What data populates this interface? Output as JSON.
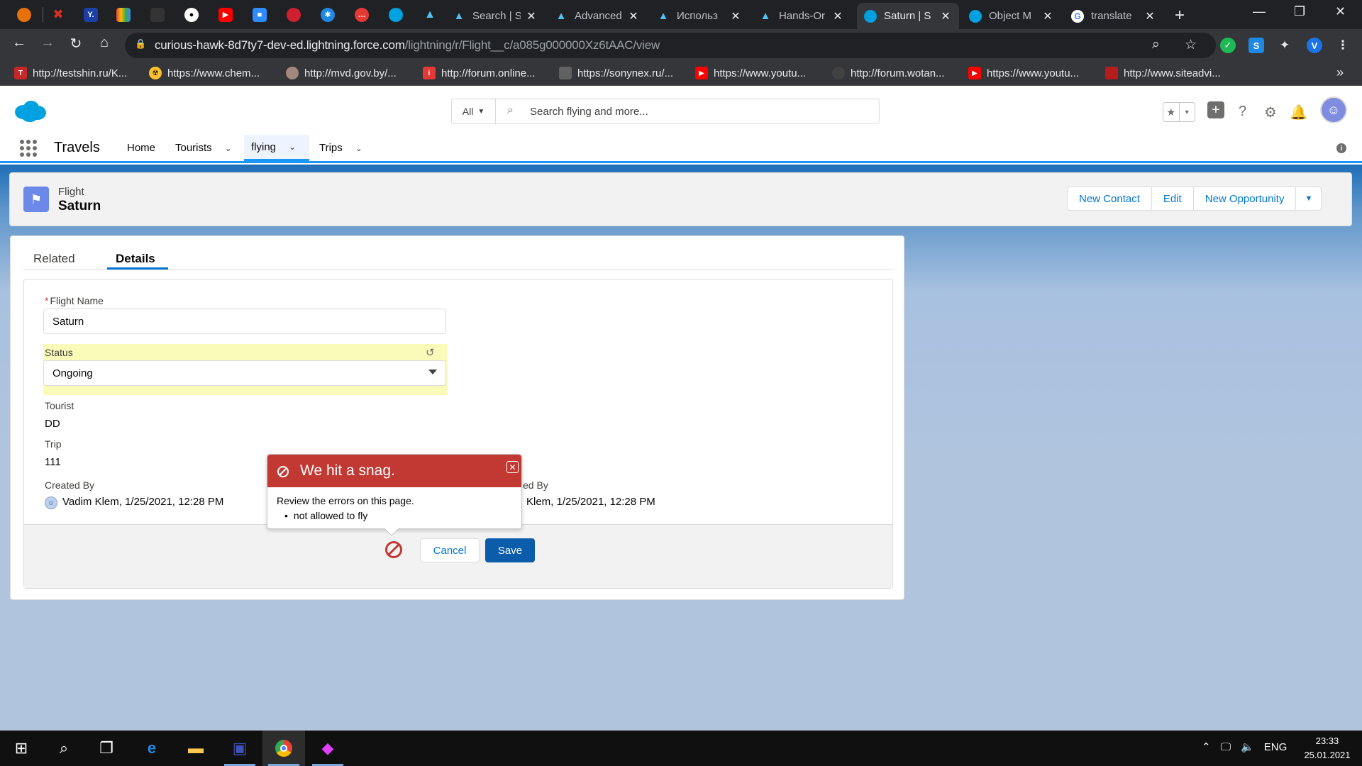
{
  "browser": {
    "tabs": [
      {
        "label": "Search | S",
        "icon": "trailhead-icon"
      },
      {
        "label": "Advanced",
        "icon": "trailhead-icon"
      },
      {
        "label": "Использ",
        "icon": "trailhead-icon"
      },
      {
        "label": "Hands-Or",
        "icon": "trailhead-icon"
      },
      {
        "label": "Saturn | S",
        "icon": "salesforce-icon",
        "active": true
      },
      {
        "label": "Object M",
        "icon": "salesforce-icon"
      },
      {
        "label": "translate",
        "icon": "google-icon"
      }
    ],
    "url_host": "curious-hawk-8d7ty7-dev-ed.lightning.force.com",
    "url_path": "/lightning/r/Flight__c/a085g000000Xz6tAAC/view",
    "profile_initial": "V",
    "bookmarks": [
      "http://testshin.ru/K...",
      "https://www.chem...",
      "http://mvd.gov.by/...",
      "http://forum.online...",
      "https://sonynex.ru/...",
      "https://www.youtu...",
      "http://forum.wotan...",
      "https://www.youtu...",
      "http://www.siteadvi..."
    ]
  },
  "sf": {
    "search_scope": "All",
    "search_placeholder": "Search flying and more...",
    "app_name": "Travels",
    "nav": [
      {
        "label": "Home"
      },
      {
        "label": "Tourists"
      },
      {
        "label": "flying",
        "active": true
      },
      {
        "label": "Trips"
      }
    ]
  },
  "record": {
    "type": "Flight",
    "title": "Saturn",
    "actions": [
      "New Contact",
      "Edit",
      "New Opportunity"
    ],
    "tabs": [
      "Related",
      "Details"
    ],
    "fields": {
      "flight_name_label": "Flight Name",
      "flight_name_required": "*",
      "flight_name_value": "Saturn",
      "status_label": "Status",
      "status_value": "Ongoing",
      "tourist_label": "Tourist",
      "tourist_value": "DD",
      "trip_label": "Trip",
      "trip_value": "111",
      "created_by_label": "Created By",
      "created_by_value": "Vadim Klem, 1/25/2021, 12:28 PM",
      "modified_by_label": "ed By",
      "modified_by_value": "Klem, 1/25/2021, 12:28 PM"
    },
    "cancel_label": "Cancel",
    "save_label": "Save"
  },
  "error_popover": {
    "title": "We hit a snag.",
    "body_title": "Review the errors on this page.",
    "errors": [
      "not allowed to fly"
    ]
  },
  "taskbar": {
    "tray_lang": "ENG",
    "time": "23:33",
    "date": "25.01.2021"
  }
}
